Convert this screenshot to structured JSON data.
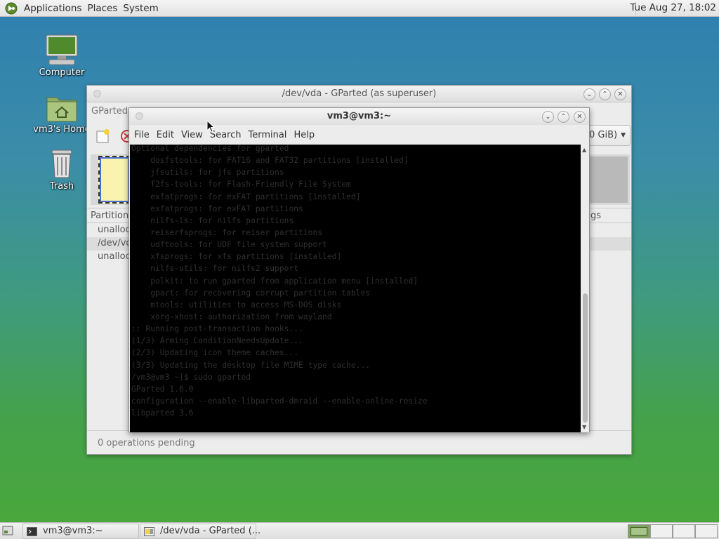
{
  "top_panel": {
    "menus": [
      "Applications",
      "Places",
      "System"
    ],
    "clock": "Tue Aug 27, 18:02",
    "logo_icon": "mate-logo-icon"
  },
  "desktop": {
    "icons": [
      {
        "label": "Computer",
        "icon": "computer-icon"
      },
      {
        "label": "vm3's Home",
        "icon": "home-folder-icon"
      },
      {
        "label": "Trash",
        "icon": "trash-icon"
      }
    ]
  },
  "gparted": {
    "title": "/dev/vda - GParted (as superuser)",
    "app_label": "GParted",
    "disk_size": "0 GiB)",
    "columns": [
      "Partition",
      "ags"
    ],
    "rows": [
      "unalloca",
      "/dev/vd",
      "unalloca"
    ],
    "status": "0 operations pending"
  },
  "terminal": {
    "title": "vm3@vm3:~",
    "menus": [
      "File",
      "Edit",
      "View",
      "Search",
      "Terminal",
      "Help"
    ],
    "lines": [
      "Optional dependencies for gparted",
      "    dosfstools: for FAT16 and FAT32 partitions [installed]",
      "    jfsutils: for jfs partitions",
      "    f2fs-tools: for Flash-Friendly File System",
      "    exfatprogs: for exFAT partitions [installed]",
      "    exfatprogs: for exFAT partitions",
      "    nilfs-ls: for nilfs partitions",
      "    reiserfsprogs: for reiser partitions",
      "    udftools: for UDF file system support",
      "    xfsprogs: for xfs partitions [installed]",
      "    nilfs-utils: for nilfs2 support",
      "    polkit: to run gparted from application menu [installed]",
      "    gpart: for recovering corrupt partition tables",
      "    mtools: utilities to access MS-DOS disks",
      "    xorg-xhost: authorization from wayland",
      ":: Running post-transaction hooks...",
      "(1/3) Arming ConditionNeedsUpdate...",
      "(2/3) Updating icon theme caches...",
      "(3/3) Updating the desktop file MIME type cache...",
      "/vm3@vm3 ~]$ sudo gparted",
      "GParted 1.6.0",
      "configuration --enable-libparted-dmraid --enable-online-resize",
      "libparted 3.6"
    ]
  },
  "taskbar": {
    "tasks": [
      {
        "label": "vm3@vm3:~",
        "icon": "terminal-icon"
      },
      {
        "label": "/dev/vda - GParted (...",
        "icon": "gparted-icon"
      }
    ],
    "workspaces": 4
  }
}
